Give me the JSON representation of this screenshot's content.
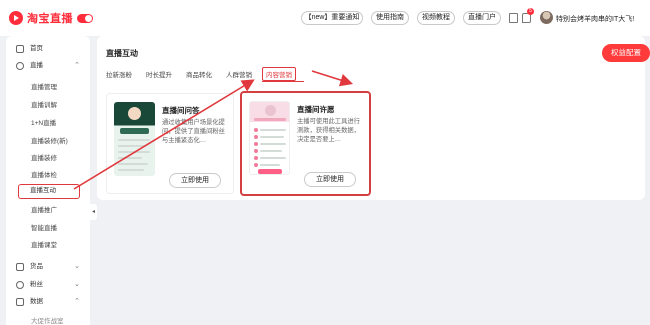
{
  "header": {
    "logo_text": "淘宝直播",
    "buttons": [
      "【new】重要通知",
      "使用指南",
      "视频教程",
      "直播门户"
    ],
    "notification_count": "5",
    "username": "特别会烤羊肉串的IT大飞!"
  },
  "sidebar": {
    "items": [
      {
        "label": "首页",
        "kind": "top",
        "icon": "home-icon"
      },
      {
        "label": "直播",
        "kind": "top",
        "icon": "live-icon",
        "expanded": true
      },
      {
        "label": "直播管理",
        "kind": "sub"
      },
      {
        "label": "直播训解",
        "kind": "sub"
      },
      {
        "label": "1+N直播",
        "kind": "sub"
      },
      {
        "label": "直播装修(新)",
        "kind": "sub"
      },
      {
        "label": "直播装修",
        "kind": "sub"
      },
      {
        "label": "直播体检",
        "kind": "sub"
      },
      {
        "label": "直播互动",
        "kind": "sub",
        "active": true
      },
      {
        "label": "直播推广",
        "kind": "sub"
      },
      {
        "label": "智能直播",
        "kind": "sub"
      },
      {
        "label": "直播课堂",
        "kind": "sub"
      },
      {
        "label": "货品",
        "kind": "top",
        "icon": "goods-icon"
      },
      {
        "label": "粉丝",
        "kind": "top",
        "icon": "fans-icon"
      },
      {
        "label": "数据",
        "kind": "top",
        "icon": "data-icon"
      },
      {
        "label": "大促作战室",
        "kind": "sub"
      }
    ]
  },
  "main": {
    "title": "直播互动",
    "quota_button": "权益配置",
    "tabs": [
      "拉新涨粉",
      "时长提升",
      "商品转化",
      "人群营销",
      "内容营销"
    ],
    "active_tab": "内容营销",
    "cards": [
      {
        "title": "直播间问答",
        "description": "通过收集用户场景化提问，提供了直播间粉丝与主播紧态化…",
        "button": "立即使用",
        "highlighted": false
      },
      {
        "title": "直播间许愿",
        "description": "主播可使用此工具进行测款，获得相关数据，决定是否要上…",
        "button": "立即使用",
        "highlighted": true
      }
    ]
  },
  "colors": {
    "brand_red": "#ff2d3c",
    "annotation_red": "#e0383c",
    "background": "#f0f1f5"
  }
}
